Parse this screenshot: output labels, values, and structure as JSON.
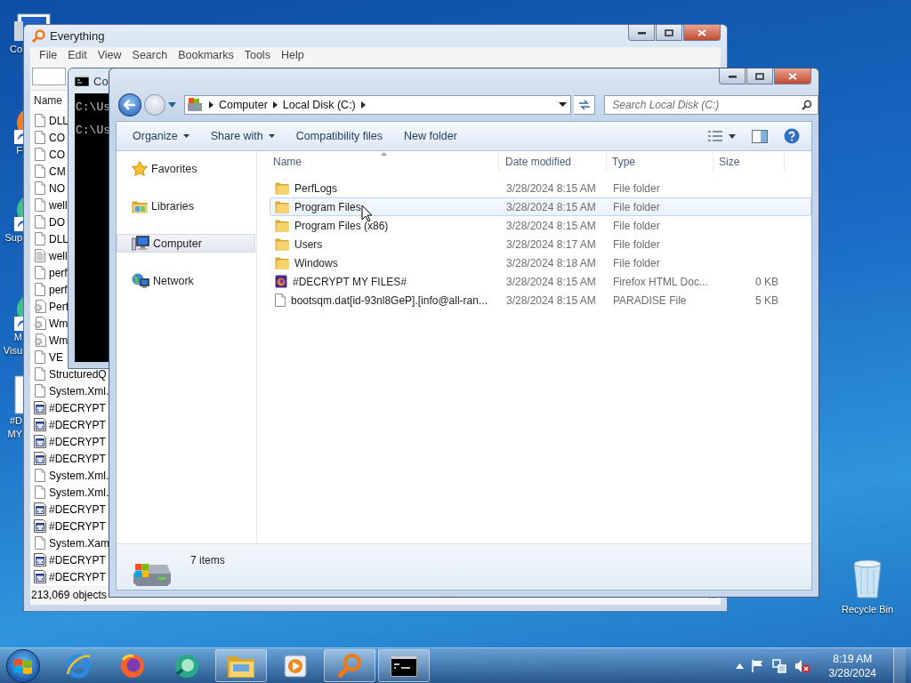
{
  "desktop": {
    "icons": [
      {
        "kind": "computer",
        "lines": [
          "Co"
        ]
      },
      {
        "kind": "firefox",
        "lines": [
          "F"
        ]
      },
      {
        "kind": "app",
        "lines": [
          "Sup"
        ]
      },
      {
        "kind": "app",
        "lines": [
          "M",
          "Visu"
        ]
      },
      {
        "kind": "file",
        "lines": [
          "#D",
          "MY"
        ]
      }
    ],
    "recycle_bin": {
      "label": "Recycle Bin"
    }
  },
  "everything": {
    "title": "Everything",
    "menu": [
      "File",
      "Edit",
      "View",
      "Search",
      "Bookmarks",
      "Tools",
      "Help"
    ],
    "column": "Name",
    "rows": [
      {
        "name": "DLL",
        "kind": "file"
      },
      {
        "name": "CO",
        "kind": "file"
      },
      {
        "name": "CO",
        "kind": "file"
      },
      {
        "name": "CM",
        "kind": "file"
      },
      {
        "name": "NO",
        "kind": "file"
      },
      {
        "name": "well",
        "kind": "file"
      },
      {
        "name": "DO",
        "kind": "file"
      },
      {
        "name": "DLL",
        "kind": "file"
      },
      {
        "name": "well",
        "kind": "text"
      },
      {
        "name": "perf",
        "kind": "file"
      },
      {
        "name": "perf",
        "kind": "file"
      },
      {
        "name": "Perf",
        "kind": "config"
      },
      {
        "name": "Wm",
        "kind": "config"
      },
      {
        "name": "Wm",
        "kind": "config"
      },
      {
        "name": "VE",
        "kind": "file"
      },
      {
        "name": "StructuredQ",
        "kind": "file"
      },
      {
        "name": "System.Xml.",
        "kind": "file"
      },
      {
        "name": "#DECRYPT",
        "kind": "html"
      },
      {
        "name": "#DECRYPT",
        "kind": "html"
      },
      {
        "name": "#DECRYPT",
        "kind": "html"
      },
      {
        "name": "#DECRYPT",
        "kind": "html"
      },
      {
        "name": "System.Xml.",
        "kind": "file"
      },
      {
        "name": "System.Xml.",
        "kind": "file"
      },
      {
        "name": "#DECRYPT",
        "kind": "html"
      },
      {
        "name": "#DECRYPT",
        "kind": "html"
      },
      {
        "name": "System.Xam",
        "kind": "file"
      },
      {
        "name": "#DECRYPT",
        "kind": "html"
      },
      {
        "name": "#DECRYPT",
        "kind": "html"
      }
    ],
    "status": "213,069 objects"
  },
  "cmd": {
    "title": "Co",
    "lines": [
      "C:\\Us",
      "C:\\Us"
    ]
  },
  "explorer": {
    "address": [
      "Computer",
      "Local Disk (C:)"
    ],
    "search": {
      "placeholder": "Search Local Disk (C:)"
    },
    "toolbar": [
      {
        "label": "Organize",
        "dropdown": true
      },
      {
        "label": "Share with",
        "dropdown": true
      },
      {
        "label": "Compatibility files",
        "dropdown": false
      },
      {
        "label": "New folder",
        "dropdown": false
      }
    ],
    "nav": [
      {
        "label": "Favorites",
        "kind": "star",
        "selected": false
      },
      {
        "label": "Libraries",
        "kind": "library",
        "selected": false
      },
      {
        "label": "Computer",
        "kind": "computer",
        "selected": true
      },
      {
        "label": "Network",
        "kind": "network",
        "selected": false
      }
    ],
    "columns": [
      "Name",
      "Date modified",
      "Type",
      "Size"
    ],
    "rows": [
      {
        "name": "PerfLogs",
        "date": "3/28/2024 8:15 AM",
        "type": "File folder",
        "kind": "folder",
        "highlighted": false
      },
      {
        "name": "Program Files",
        "date": "3/28/2024 8:15 AM",
        "type": "File folder",
        "kind": "folder",
        "highlighted": true
      },
      {
        "name": "Program Files (x86)",
        "date": "3/28/2024 8:15 AM",
        "type": "File folder",
        "kind": "folder",
        "highlighted": false
      },
      {
        "name": "Users",
        "date": "3/28/2024 8:17 AM",
        "type": "File folder",
        "kind": "folder",
        "highlighted": false
      },
      {
        "name": "Windows",
        "date": "3/28/2024 8:18 AM",
        "type": "File folder",
        "kind": "folder",
        "highlighted": false
      },
      {
        "name": "#DECRYPT MY FILES#",
        "date": "3/28/2024 8:15 AM",
        "type": "Firefox HTML Doc...",
        "size": "0 KB",
        "kind": "html",
        "highlighted": false
      },
      {
        "name": "bootsqm.dat[id-93nl8GeP].[info@all-ran...",
        "date": "3/28/2024 8:15 AM",
        "type": "PARADISE File",
        "size": "5 KB",
        "kind": "file",
        "highlighted": false
      }
    ],
    "status": "7 items"
  },
  "taskbar": {
    "apps": [
      {
        "kind": "ie",
        "open": false
      },
      {
        "kind": "firefox",
        "open": false
      },
      {
        "kind": "app",
        "open": false
      },
      {
        "kind": "explorer",
        "open": true
      },
      {
        "kind": "media",
        "open": false
      },
      {
        "kind": "everything",
        "open": true
      },
      {
        "kind": "cmd",
        "open": true
      }
    ],
    "tray": {
      "muted": true
    },
    "clock": {
      "time": "8:19 AM",
      "date": "3/28/2024"
    }
  }
}
